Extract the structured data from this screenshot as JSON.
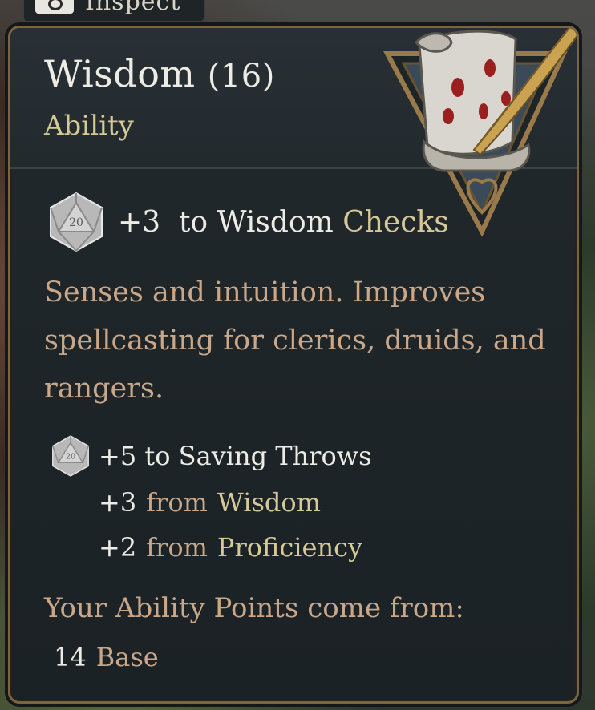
{
  "top_tab": {
    "label": "Inspect",
    "icon": "inspect-icon"
  },
  "tooltip": {
    "title_name": "Wisdom",
    "title_value": "(16)",
    "subtitle": "Ability",
    "emblem_icon": "scroll-and-quill-icon",
    "check": {
      "icon": "d20-icon",
      "modifier": "+3",
      "text": "to Wisdom",
      "accent": "Checks"
    },
    "description": "Senses and intuition. Improves spellcasting for clerics, druids, and rangers.",
    "saving_throws": {
      "icon": "d20-icon",
      "title": "+5 to Saving Throws",
      "lines": [
        {
          "value": "+3",
          "from": "from",
          "source": "Wisdom"
        },
        {
          "value": "+2",
          "from": "from",
          "source": "Proficiency"
        }
      ]
    },
    "ability_points": {
      "title": "Your Ability Points come from:",
      "lines": [
        {
          "value": "14",
          "source": "Base"
        }
      ]
    }
  },
  "colors": {
    "text_light": "#ecebe4",
    "text_gold": "#d6c998",
    "text_tan": "#c9a788",
    "panel_bg": "#1d2428",
    "border": "#7a6442"
  }
}
